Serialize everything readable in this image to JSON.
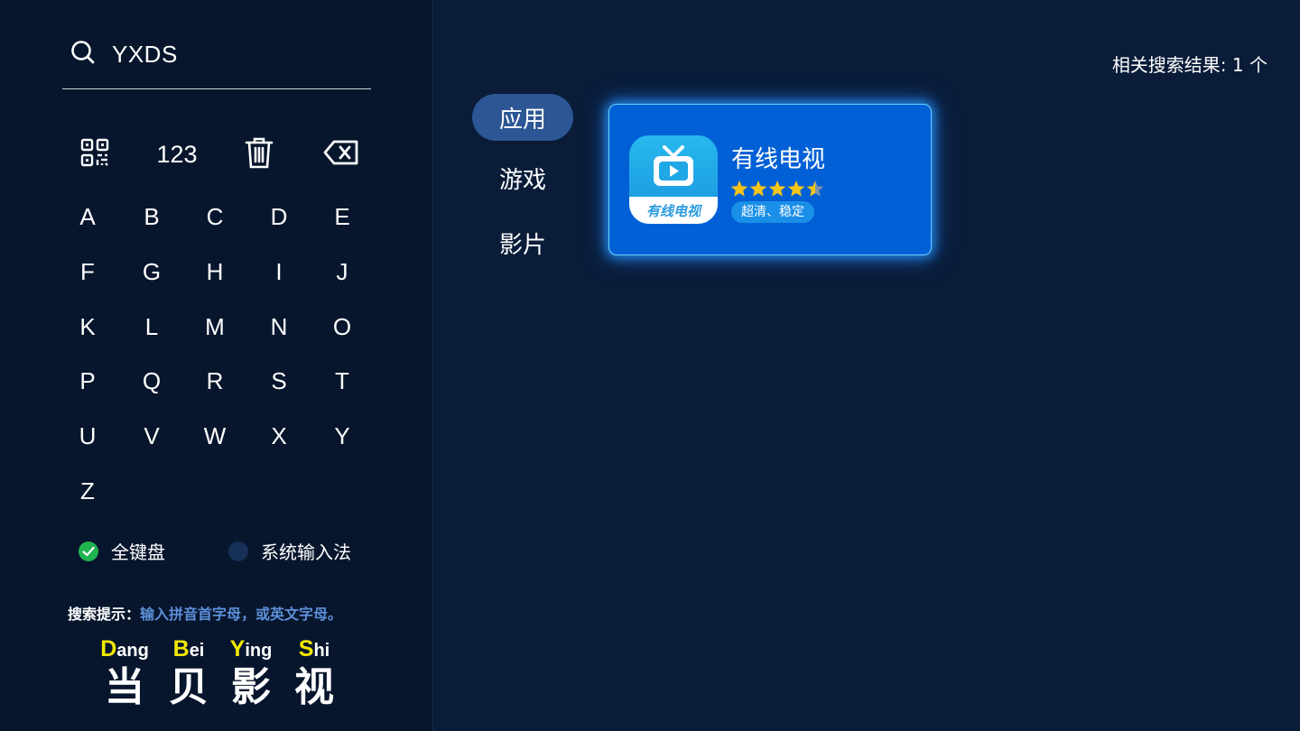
{
  "search": {
    "query": "YXDS"
  },
  "toolbar": {
    "numbers_label": "123"
  },
  "keyboard": {
    "keys": [
      "A",
      "B",
      "C",
      "D",
      "E",
      "F",
      "G",
      "H",
      "I",
      "J",
      "K",
      "L",
      "M",
      "N",
      "O",
      "P",
      "Q",
      "R",
      "S",
      "T",
      "U",
      "V",
      "W",
      "X",
      "Y",
      "Z"
    ]
  },
  "input_modes": [
    {
      "label": "全键盘",
      "selected": true
    },
    {
      "label": "系统输入法",
      "selected": false
    }
  ],
  "hint": {
    "label": "搜索提示：",
    "text": "输入拼音首字母，或英文字母。"
  },
  "brand": [
    {
      "cap": "D",
      "rest": "ang",
      "cn": "当"
    },
    {
      "cap": "B",
      "rest": "ei",
      "cn": "贝"
    },
    {
      "cap": "Y",
      "rest": "ing",
      "cn": "影"
    },
    {
      "cap": "S",
      "rest": "hi",
      "cn": "视"
    }
  ],
  "categories": [
    {
      "label": "应用",
      "active": true
    },
    {
      "label": "游戏",
      "active": false
    },
    {
      "label": "影片",
      "active": false
    }
  ],
  "results": {
    "count_text": "相关搜索结果: 1 个",
    "items": [
      {
        "name": "有线电视",
        "icon_text": "有线电视",
        "rating": 4.5,
        "tag": "超清、稳定"
      }
    ]
  },
  "colors": {
    "background": "#0a1c38",
    "sidebar": "#08162d",
    "card": "#0260d6",
    "accent_yellow": "#f3e800",
    "selected_green": "#1fb450",
    "star": "#f5c518"
  }
}
